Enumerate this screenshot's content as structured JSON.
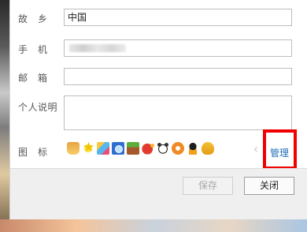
{
  "form": {
    "hometown": {
      "label": "故　乡",
      "value": "中国"
    },
    "phone": {
      "label": "手　机",
      "value": ""
    },
    "email": {
      "label": "邮　箱",
      "value": ""
    },
    "bio": {
      "label": "个人说明",
      "value": ""
    },
    "icons": {
      "label": "图　标",
      "items": [
        "vip-icon",
        "star-icon",
        "app-icon",
        "camera-icon",
        "gift-icon",
        "video-icon",
        "cow-icon",
        "orange-circle-icon",
        "qq-penguin-icon",
        "bell-icon"
      ],
      "prev_arrow": "‹",
      "manage_label": "管理"
    }
  },
  "footer": {
    "save_label": "保存",
    "close_label": "关闭"
  },
  "colors": {
    "link": "#1f6fb8",
    "highlight": "#f20000"
  }
}
